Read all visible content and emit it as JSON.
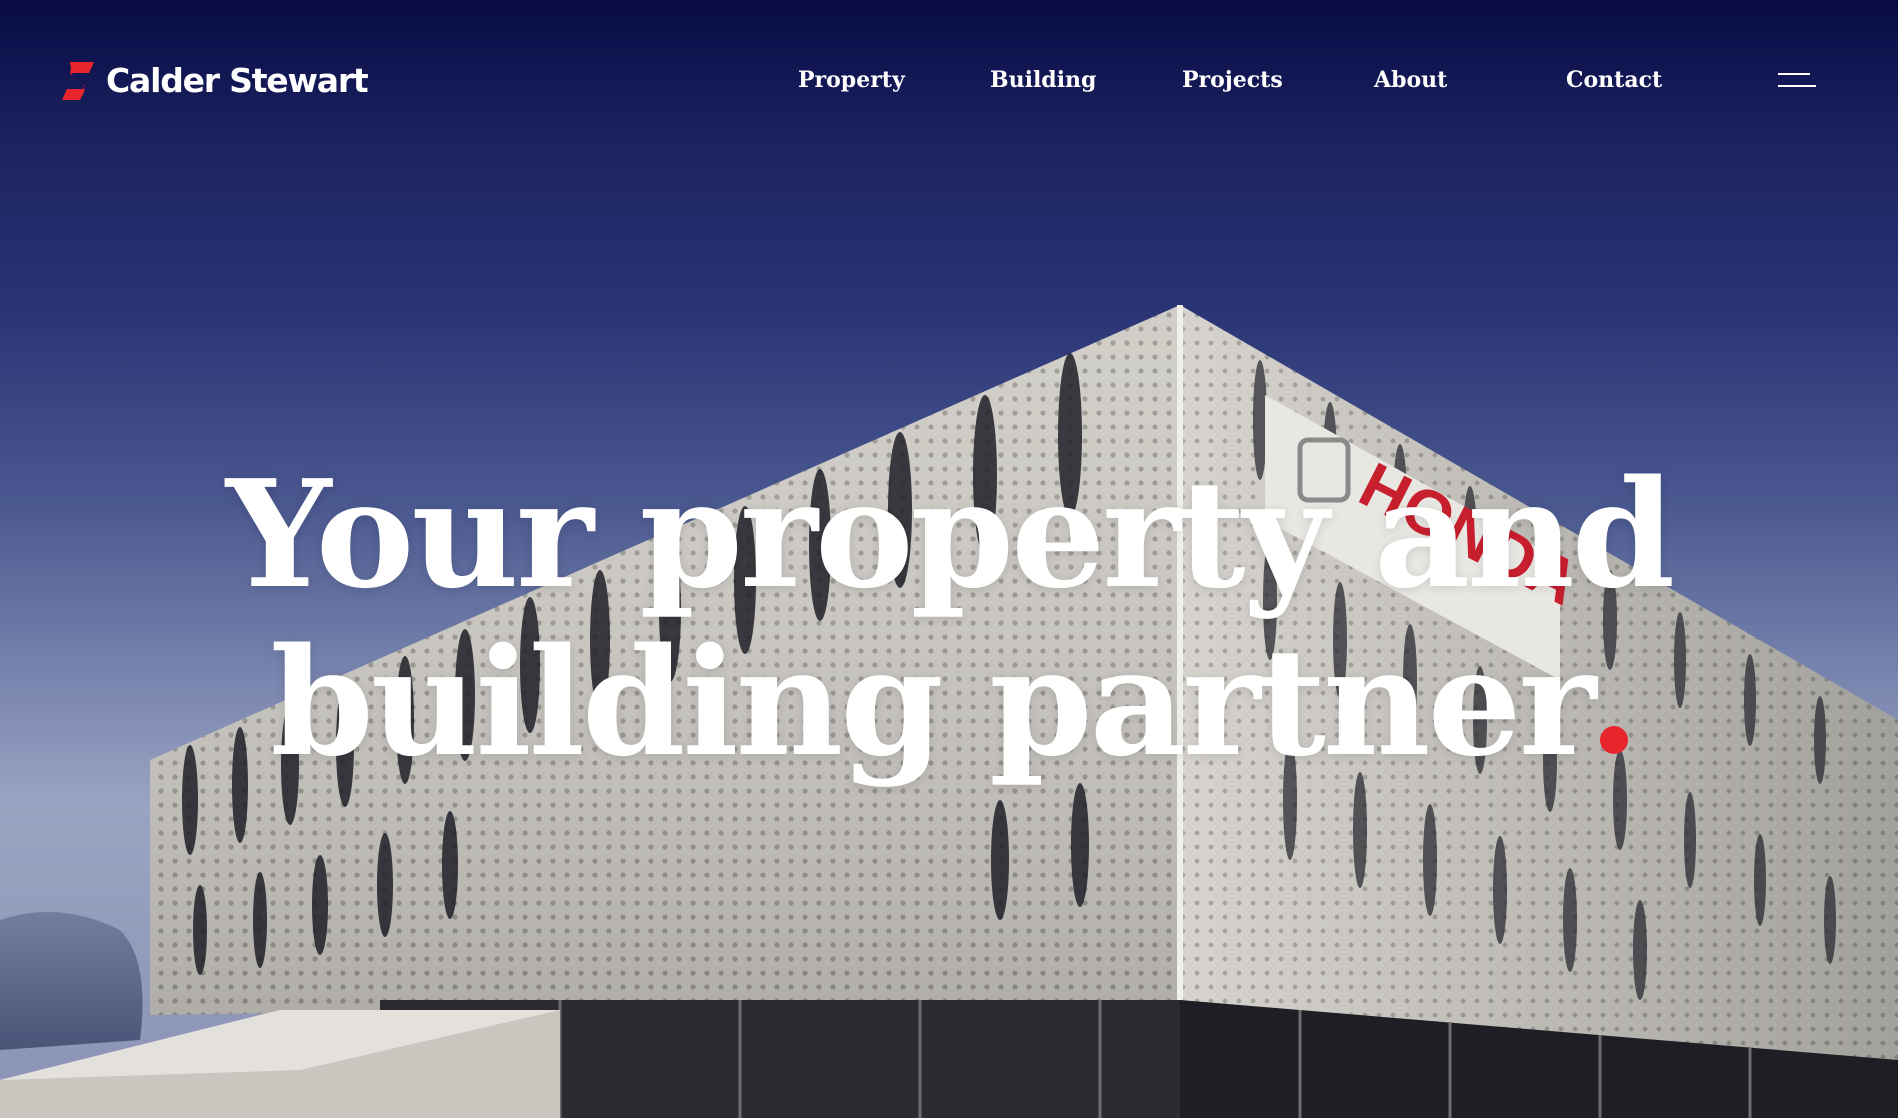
{
  "brand": {
    "name": "Calder Stewart",
    "accent_color": "#e8252d"
  },
  "nav": {
    "items": [
      {
        "label": "Property"
      },
      {
        "label": "Building"
      },
      {
        "label": "Projects"
      },
      {
        "label": "About"
      },
      {
        "label": "Contact"
      }
    ],
    "menu_icon": "hamburger-menu-icon"
  },
  "hero": {
    "headline_line1": "Your property and",
    "headline_line2": "building partner",
    "headline_end_mark": "red-dot",
    "image": "perforated-facade-building-photo",
    "sign_text": "HONDA"
  }
}
